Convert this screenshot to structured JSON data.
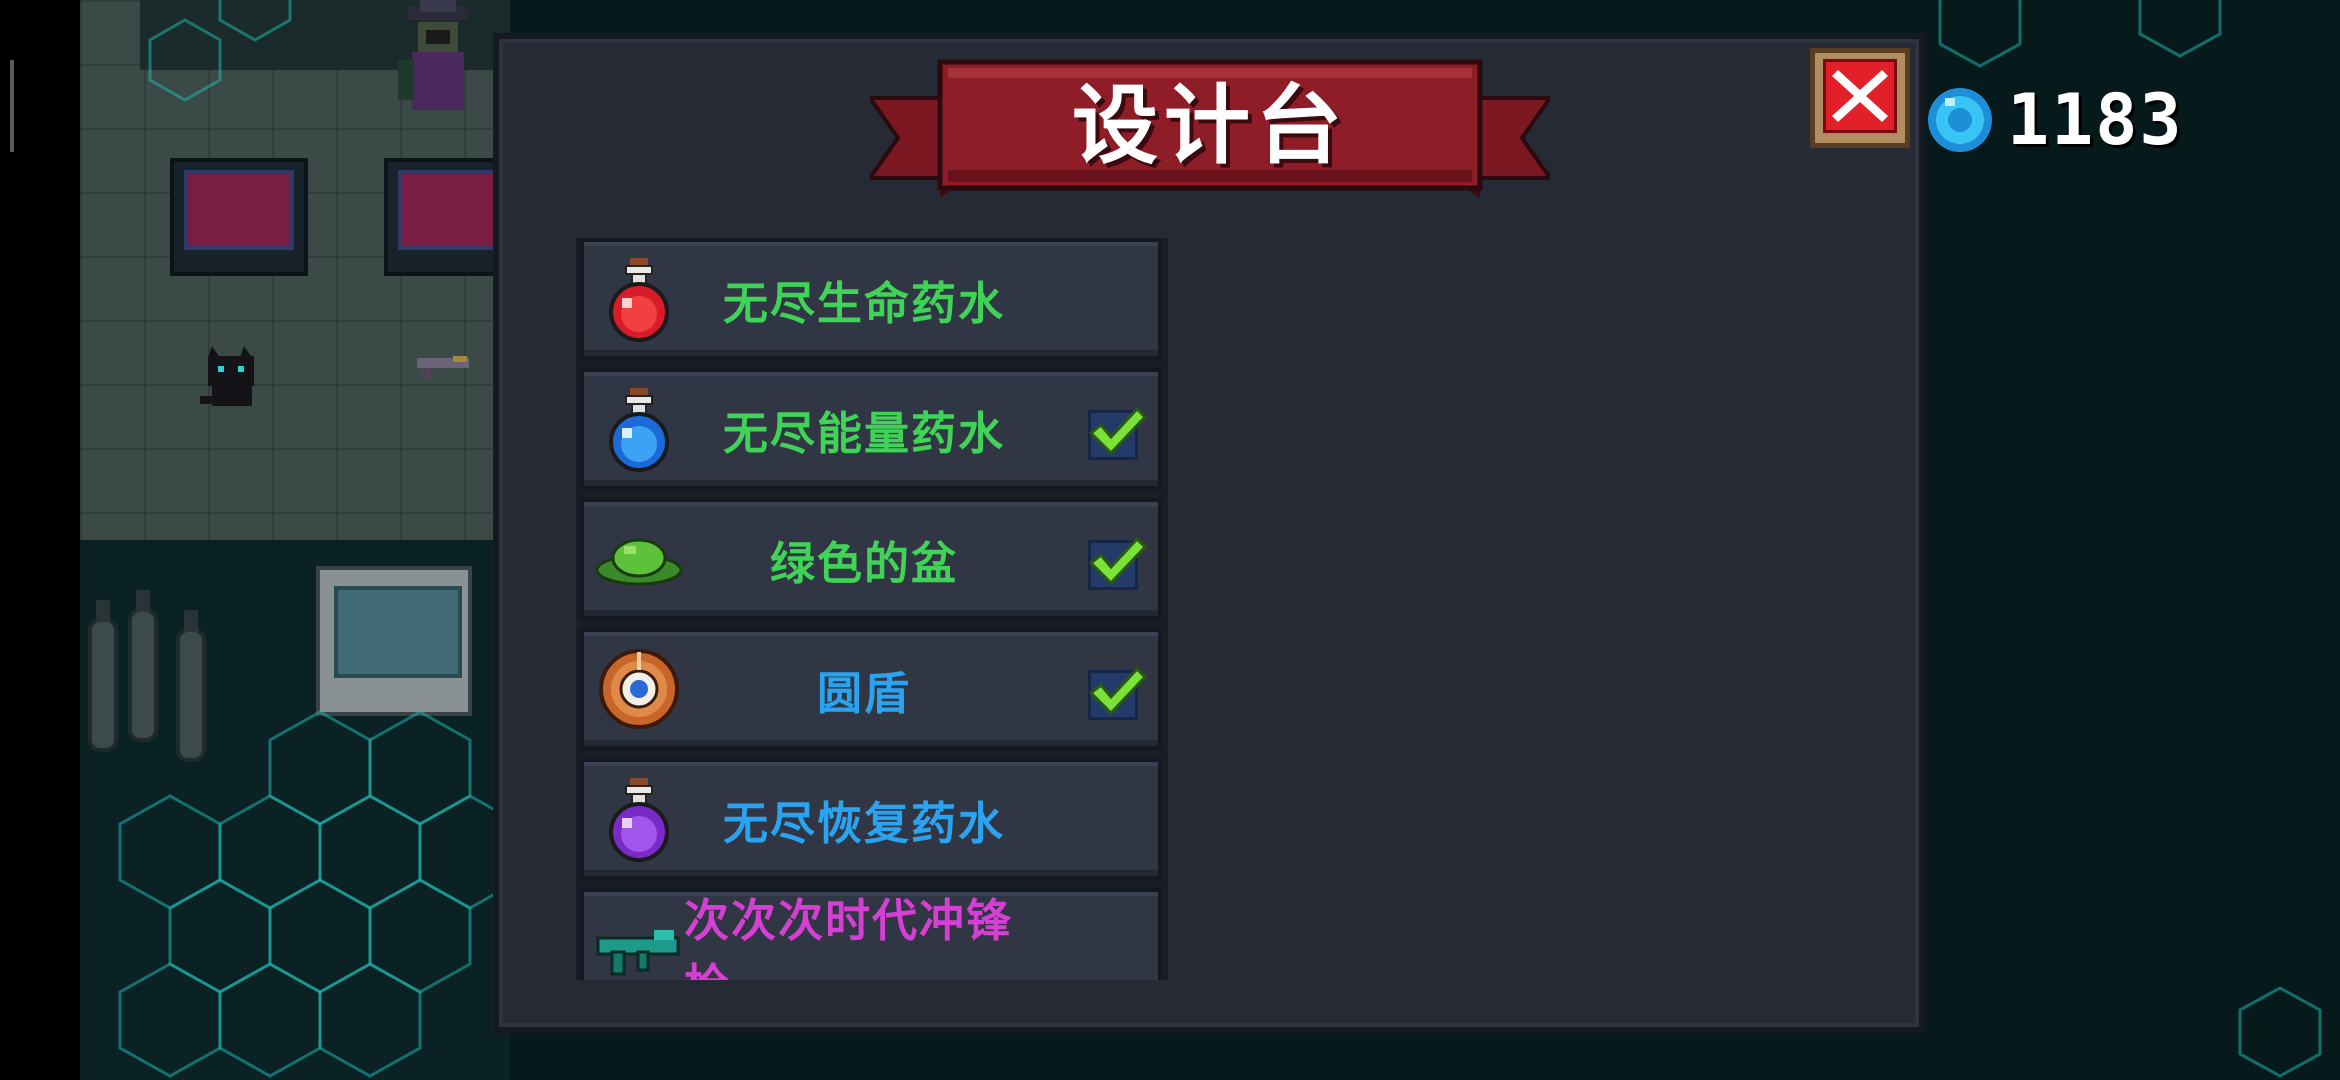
{
  "panel": {
    "title": "设计台",
    "close_label": "X"
  },
  "currency": {
    "icon": "blue-gem-icon",
    "amount": "1183"
  },
  "items": [
    {
      "name": "无尽生命药水",
      "icon": "red-potion-icon",
      "color": "#3fd457",
      "checked": false
    },
    {
      "name": "无尽能量药水",
      "icon": "blue-potion-icon",
      "color": "#3fd457",
      "checked": true
    },
    {
      "name": "绿色的盆",
      "icon": "green-bowl-icon",
      "color": "#3fd457",
      "checked": true
    },
    {
      "name": "圆盾",
      "icon": "round-shield-icon",
      "color": "#2aa4f0",
      "checked": true
    },
    {
      "name": "无尽恢复药水",
      "icon": "purple-potion-icon",
      "color": "#2aa4f0",
      "checked": false
    },
    {
      "name": "次次次时代冲锋枪",
      "icon": "smg-icon",
      "color": "#d63fd4",
      "checked": false
    }
  ],
  "colors": {
    "panel_bg": "#262a35",
    "banner_red": "#8e1d28",
    "check_green": "#7be23a"
  }
}
